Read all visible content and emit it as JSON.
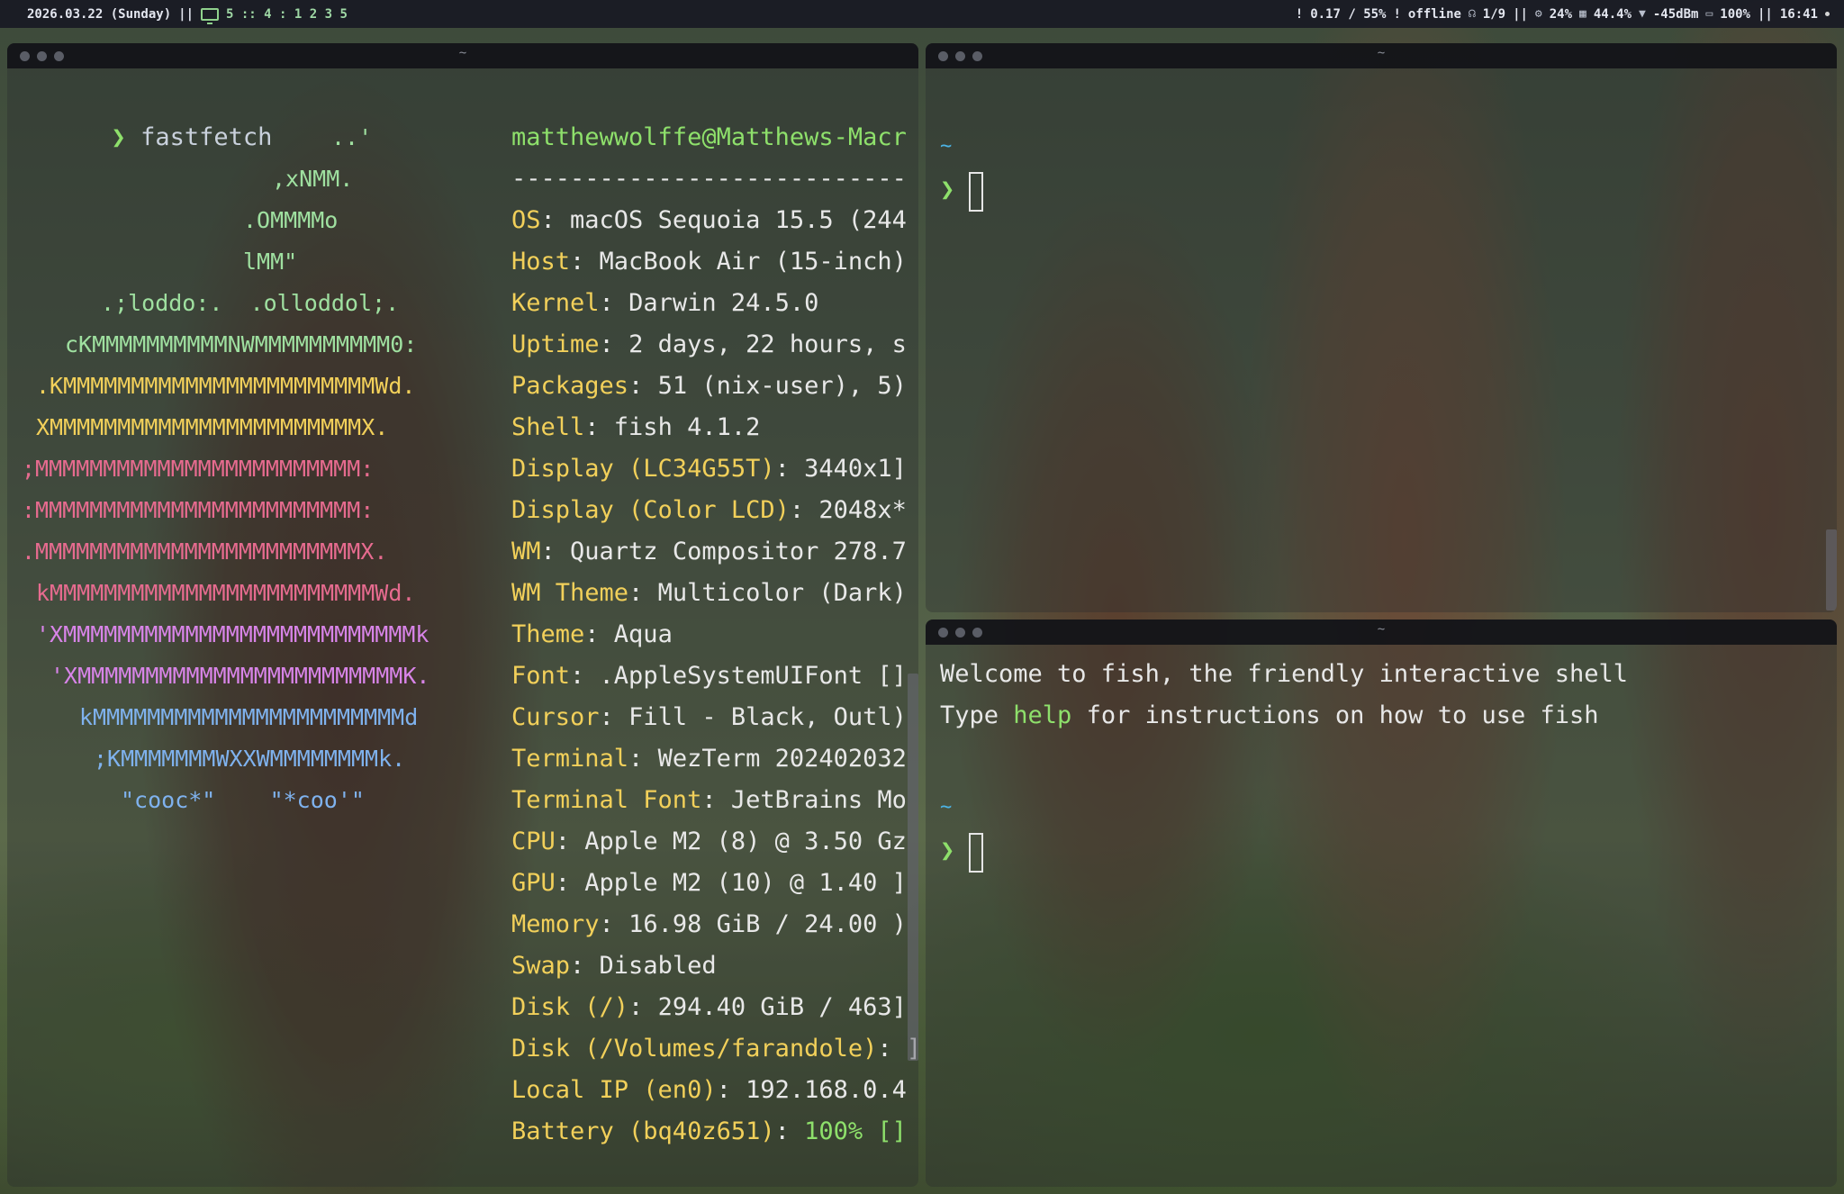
{
  "topbar": {
    "date": "2026.03.22 (Sunday)",
    "sep": "||",
    "workspaces": "5 :: 4 : 1 2 3 5",
    "load": "0.17 / 55%",
    "network": "offline",
    "bluetooth": "1/9",
    "cpu": "24%",
    "memory": "44.4%",
    "wifi": "-45dBm",
    "battery": "100%",
    "time": "16:41"
  },
  "left_window": {
    "title": "~",
    "prompt_symbol": "❯",
    "command": "fastfetch",
    "logo_lines": [
      {
        "text": "..'",
        "color": "#9fe0a0"
      },
      {
        "text": ",xNMM.",
        "color": "#9fe0a0"
      },
      {
        "text": ".OMMMMo",
        "color": "#9fe0a0"
      },
      {
        "text": "lMM\"",
        "color": "#9fe0a0"
      },
      {
        "text": ".;loddo:.  .olloddol;.",
        "color": "#9fe0a0"
      },
      {
        "text": "cKMMMMMMMMMMNWMMMMMMMMMM0:",
        "color": "#9fe0a0"
      },
      {
        "text": ".KMMMMMMMMMMMMMMMMMMMMMMMWd.",
        "color": "#f2d05a"
      },
      {
        "text": "XMMMMMMMMMMMMMMMMMMMMMMMX.",
        "color": "#f2d05a"
      },
      {
        "text": ";MMMMMMMMMMMMMMMMMMMMMMMM:",
        "color": "#e66b8f"
      },
      {
        "text": ":MMMMMMMMMMMMMMMMMMMMMMMM:",
        "color": "#e66b8f"
      },
      {
        "text": ".MMMMMMMMMMMMMMMMMMMMMMMMX.",
        "color": "#e66b8f"
      },
      {
        "text": "kMMMMMMMMMMMMMMMMMMMMMMMMWd.",
        "color": "#e66b8f"
      },
      {
        "text": "'XMMMMMMMMMMMMMMMMMMMMMMMMMMk",
        "color": "#d884e8"
      },
      {
        "text": "'XMMMMMMMMMMMMMMMMMMMMMMMMK.",
        "color": "#d884e8"
      },
      {
        "text": "kMMMMMMMMMMMMMMMMMMMMMMMd",
        "color": "#7fb2ee"
      },
      {
        "text": ";KMMMMMMMWXXWMMMMMMMMk.",
        "color": "#7fb2ee"
      },
      {
        "text": "\"cooc*\"    \"*coo'\"",
        "color": "#7fb2ee"
      }
    ],
    "user_host": "matthewwolffe@Matthews-Macr",
    "separator": "---------------------------",
    "info": [
      {
        "key": "OS",
        "value": "macOS Sequoia 15.5 (244"
      },
      {
        "key": "Host",
        "value": "MacBook Air (15-inch)"
      },
      {
        "key": "Kernel",
        "value": "Darwin 24.5.0"
      },
      {
        "key": "Uptime",
        "value": "2 days, 22 hours, s"
      },
      {
        "key": "Packages",
        "value": "51 (nix-user), 5)"
      },
      {
        "key": "Shell",
        "value": "fish 4.1.2"
      },
      {
        "key": "Display (LC34G55T)",
        "value": "3440x1]"
      },
      {
        "key": "Display (Color LCD)",
        "value": "2048x*"
      },
      {
        "key": "WM",
        "value": "Quartz Compositor 278.7"
      },
      {
        "key": "WM Theme",
        "value": "Multicolor (Dark)"
      },
      {
        "key": "Theme",
        "value": "Aqua"
      },
      {
        "key": "Font",
        "value": ".AppleSystemUIFont []"
      },
      {
        "key": "Cursor",
        "value": "Fill - Black, Outl)"
      },
      {
        "key": "Terminal",
        "value": "WezTerm 202402032"
      },
      {
        "key": "Terminal Font",
        "value": "JetBrains Mo"
      },
      {
        "key": "CPU",
        "value": "Apple M2 (8) @ 3.50 Gz"
      },
      {
        "key": "GPU",
        "value": "Apple M2 (10) @ 1.40 ]"
      },
      {
        "key": "Memory",
        "value": "16.98 GiB / 24.00 )"
      },
      {
        "key": "Swap",
        "value": "Disabled"
      },
      {
        "key": "Disk (/)",
        "value": "294.40 GiB / 463]"
      },
      {
        "key": "Disk (/Volumes/farandole)",
        "value": "]"
      },
      {
        "key": "Local IP (en0)",
        "value": "192.168.0.4"
      },
      {
        "key": "Battery (bq40z651)",
        "value": "100% []"
      }
    ]
  },
  "top_right_window": {
    "title": "~",
    "cwd": "~",
    "prompt_symbol": "❯"
  },
  "bottom_right_window": {
    "title": "~",
    "welcome_line": "Welcome to fish, the friendly interactive shell",
    "help_pre": "Type ",
    "help_word": "help",
    "help_post": " for instructions on how to use fish",
    "cwd": "~",
    "prompt_symbol": "❯"
  },
  "colors": {
    "key": "#f2d05a",
    "prompt": "#8ee06b",
    "tilde": "#4cb4e6",
    "battery_value": "#8ee06b"
  }
}
